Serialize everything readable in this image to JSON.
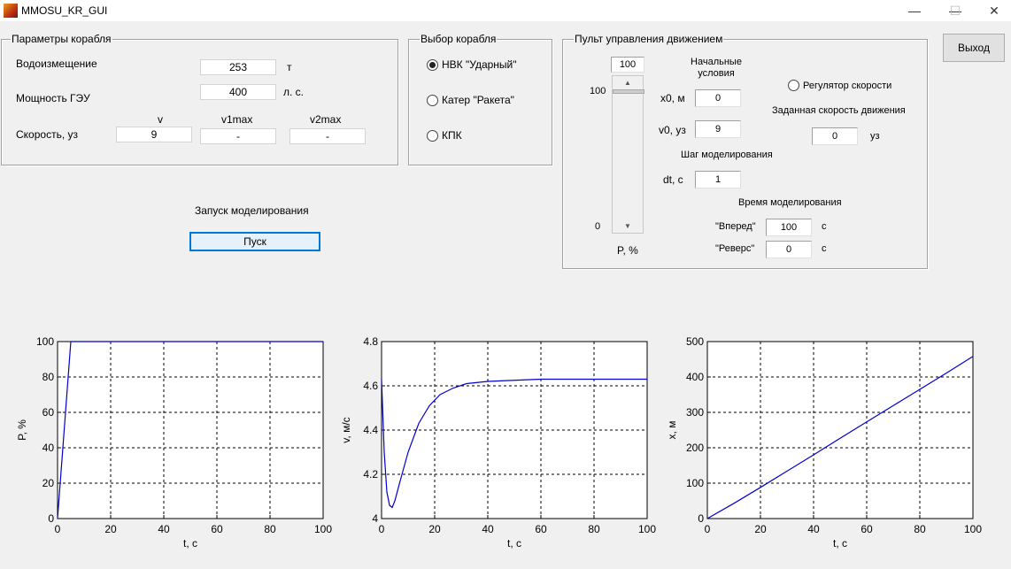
{
  "window": {
    "title": "MMOSU_KR_GUI",
    "minimize": "—",
    "maximize": "☐",
    "close": "✕"
  },
  "ship_params": {
    "title": "Параметры корабля",
    "displacement_label": "Водоизмещение",
    "displacement_value": "253",
    "displacement_unit": "т",
    "power_label": "Мощность ГЭУ",
    "power_value": "400",
    "power_unit": "л. с.",
    "speed_label": "Скорость, уз",
    "col_v": "v",
    "col_v1max": "v1max",
    "col_v2max": "v2max",
    "v_value": "9",
    "v1max_value": "-",
    "v2max_value": "-"
  },
  "ship_select": {
    "title": "Выбор корабля",
    "options": [
      {
        "label": "НВК \"Ударный\"",
        "checked": true
      },
      {
        "label": "Катер \"Ракета\"",
        "checked": false
      },
      {
        "label": "КПК",
        "checked": false
      }
    ]
  },
  "control": {
    "title": "Пульт управления движением",
    "slider_value": "100",
    "slider_max_label": "100",
    "slider_min_label": "0",
    "slider_level": 1.0,
    "slider_axis_label": "P, %",
    "initial_cond_label": "Начальные условия",
    "x0_label": "x0, м",
    "x0_value": "0",
    "v0_label": "v0, уз",
    "v0_value": "9",
    "step_label": "Шаг моделирования",
    "dt_label": "dt, с",
    "dt_value": "1",
    "speed_reg_label": "Регулятор скорости",
    "target_speed_label": "Заданная скорость движения",
    "target_speed_value": "0",
    "target_speed_unit": "уз",
    "sim_time_label": "Время моделирования",
    "forward_label": "\"Вперед\"",
    "forward_value": "100",
    "forward_unit": "с",
    "reverse_label": "\"Реверс\"",
    "reverse_value": "0",
    "reverse_unit": "с"
  },
  "exit_button": "Выход",
  "run": {
    "label": "Запуск моделирования",
    "button": "Пуск"
  },
  "colors": {
    "line": "#0000cc",
    "grid": "#000000"
  },
  "chart_data": [
    {
      "type": "line",
      "xlabel": "t, с",
      "ylabel": "P, %",
      "xlim": [
        0,
        100
      ],
      "ylim": [
        0,
        100
      ],
      "xticks": [
        0,
        20,
        40,
        60,
        80,
        100
      ],
      "yticks": [
        0,
        20,
        40,
        60,
        80,
        100
      ],
      "grid": true,
      "x": [
        0,
        1,
        2,
        3,
        4,
        5,
        100
      ],
      "y": [
        0,
        20,
        40,
        60,
        80,
        100,
        100
      ]
    },
    {
      "type": "line",
      "xlabel": "t, с",
      "ylabel": "v, м/с",
      "xlim": [
        0,
        100
      ],
      "ylim": [
        4,
        4.8
      ],
      "xticks": [
        0,
        20,
        40,
        60,
        80,
        100
      ],
      "yticks": [
        4,
        4.2,
        4.4,
        4.6,
        4.8
      ],
      "ytick_labels": [
        "4",
        "4.2",
        "4.4",
        "4.6",
        "4.8"
      ],
      "grid": true,
      "x": [
        0,
        1,
        2,
        3,
        4,
        5,
        7,
        10,
        14,
        18,
        22,
        27,
        32,
        40,
        50,
        60,
        80,
        100
      ],
      "y": [
        4.63,
        4.3,
        4.12,
        4.06,
        4.05,
        4.08,
        4.17,
        4.3,
        4.43,
        4.51,
        4.56,
        4.59,
        4.61,
        4.62,
        4.625,
        4.63,
        4.63,
        4.63
      ]
    },
    {
      "type": "line",
      "xlabel": "t, с",
      "ylabel": "x, м",
      "xlim": [
        0,
        100
      ],
      "ylim": [
        0,
        500
      ],
      "xticks": [
        0,
        20,
        40,
        60,
        80,
        100
      ],
      "yticks": [
        0,
        100,
        200,
        300,
        400,
        500
      ],
      "grid": true,
      "x": [
        0,
        10,
        20,
        30,
        40,
        50,
        60,
        70,
        80,
        90,
        100
      ],
      "y": [
        0,
        43,
        88,
        134,
        180,
        227,
        273,
        319,
        365,
        411,
        458
      ]
    }
  ]
}
